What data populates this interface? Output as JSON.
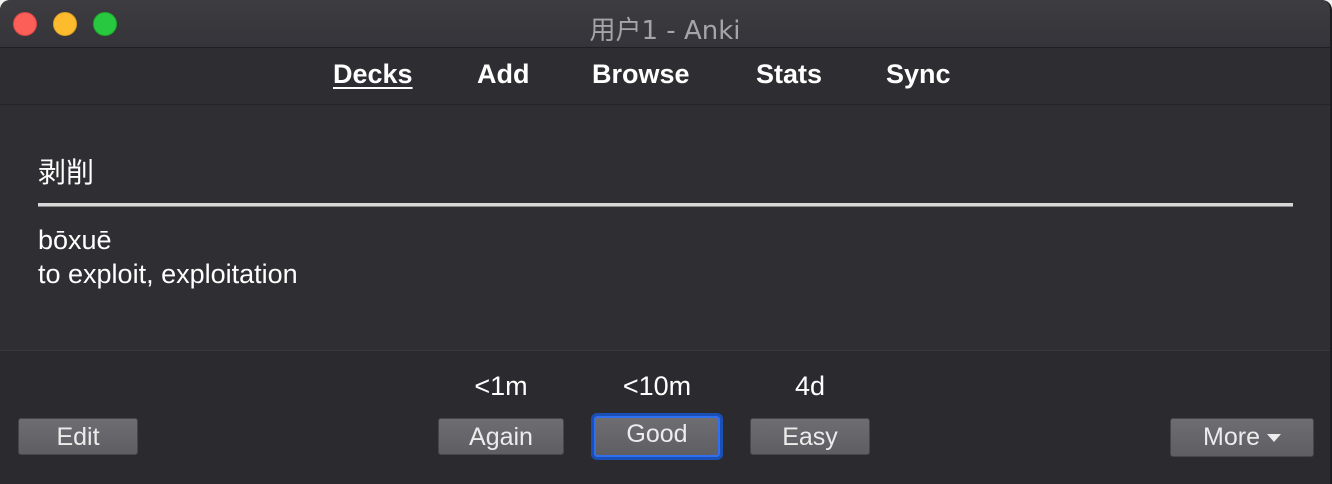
{
  "window": {
    "title": "用户1 - Anki"
  },
  "toolbar": {
    "items": [
      {
        "label": "Decks",
        "active": true
      },
      {
        "label": "Add",
        "active": false
      },
      {
        "label": "Browse",
        "active": false
      },
      {
        "label": "Stats",
        "active": false
      },
      {
        "label": "Sync",
        "active": false
      }
    ]
  },
  "card": {
    "front": "剥削",
    "back": {
      "pinyin": "bōxuē",
      "meaning": "to exploit, exploitation"
    }
  },
  "answer_bar": {
    "edit_label": "Edit",
    "more_label": "More",
    "buttons": [
      {
        "label": "Again",
        "interval": "<1m"
      },
      {
        "label": "Good",
        "interval": "<10m",
        "focused": true
      },
      {
        "label": "Easy",
        "interval": "4d"
      }
    ]
  },
  "colors": {
    "close": "#fc5f57",
    "minimize": "#fdbc2e",
    "zoom": "#28c840",
    "focus_ring": "#2f6ff0",
    "background": "#2b2a2e"
  }
}
